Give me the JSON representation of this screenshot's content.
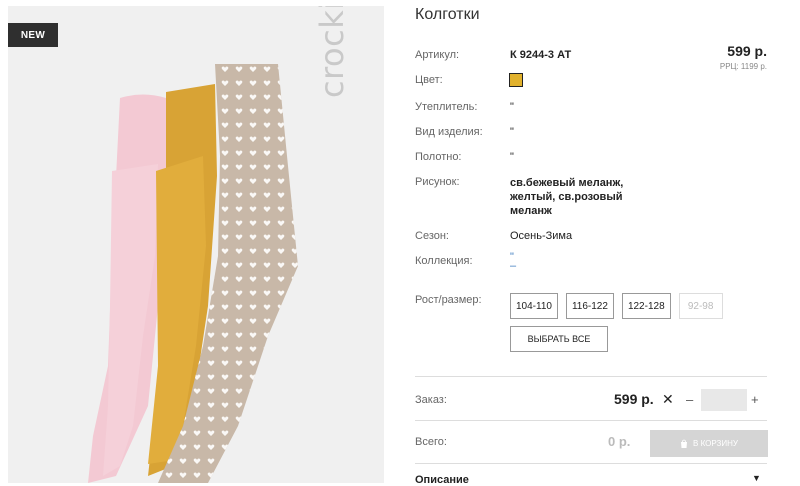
{
  "badge": "NEW",
  "brand": "crockid",
  "title": "Колготки",
  "price": "599 р.",
  "rrp": "РРЦ: 1199 р.",
  "colors": {
    "swatch": "#e1b12c"
  },
  "details": [
    {
      "label": "Артикул:",
      "value": "К 9244-3 АТ"
    },
    {
      "label": "Цвет:",
      "value": ""
    },
    {
      "label": "Утеплитель:",
      "value": "\""
    },
    {
      "label": "Вид изделия:",
      "value": "\""
    },
    {
      "label": "Полотно:",
      "value": "\""
    },
    {
      "label": "Рисунок:",
      "value": "св.бежевый меланж, желтый, св.розовый меланж"
    },
    {
      "label": "Сезон:",
      "value": "Осень-Зима"
    },
    {
      "label": "Коллекция:",
      "value": "\""
    },
    {
      "label": "Рост/размер:",
      "value": ""
    }
  ],
  "collection_dash": "–",
  "sizes": [
    "104-110",
    "116-122",
    "122-128",
    "92-98"
  ],
  "select_all": "ВЫБРАТЬ ВСЕ",
  "order": {
    "label": "Заказ:",
    "price": "599 р.",
    "times": "✕",
    "minus": "–",
    "plus": "+",
    "qty": ""
  },
  "total": {
    "label": "Всего:",
    "value": "0 р."
  },
  "cart_button": "В КОРЗИНУ",
  "description_label": "Описание",
  "icons": {
    "cart": "shopping-bag-icon",
    "chevron": "chevron-down-icon"
  }
}
